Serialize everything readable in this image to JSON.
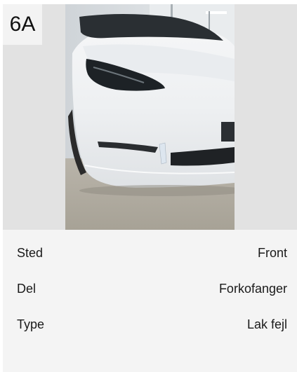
{
  "card": {
    "badge": "6A",
    "photo_alt": "Hvid Tesla front med kofanger"
  },
  "details": {
    "rows": [
      {
        "label": "Sted",
        "value": "Front"
      },
      {
        "label": "Del",
        "value": "Forkofanger"
      },
      {
        "label": "Type",
        "value": "Lak fejl"
      }
    ]
  },
  "colors": {
    "card_bg": "#e6e6e6",
    "details_bg": "#f4f4f4",
    "badge_bg": "#f3f3f3",
    "text": "#1a1a1a"
  }
}
